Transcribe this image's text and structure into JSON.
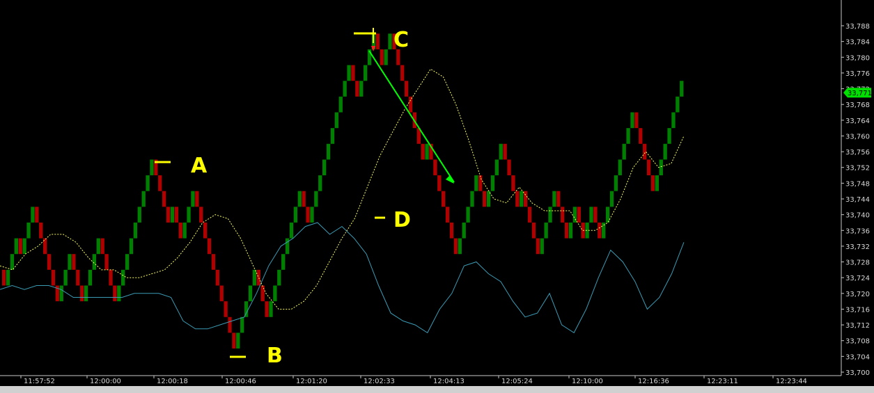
{
  "chart_data": {
    "type": "line",
    "x_ticks": [
      "11:57:52",
      "12:00:00",
      "12:00:18",
      "12:00:46",
      "12:01:20",
      "12:02:33",
      "12:04:13",
      "12:05:24",
      "12:10:00",
      "12:16:36",
      "12:23:11",
      "12:23:44"
    ],
    "y_ticks": [
      33788,
      33784,
      33780,
      33776,
      33772,
      33768,
      33764,
      33760,
      33756,
      33752,
      33748,
      33744,
      33740,
      33736,
      33732,
      33728,
      33724,
      33720,
      33716,
      33712,
      33708,
      33704,
      33700
    ],
    "ylim": [
      33700,
      33790
    ],
    "last_price": "33,771",
    "grid": false,
    "series": [
      {
        "kind": "renko_bricks",
        "color_up": "#008000",
        "color_down": "#b00000",
        "values": [
          33726,
          33722,
          33726,
          33730,
          33734,
          33730,
          33734,
          33738,
          33742,
          33738,
          33734,
          33730,
          33726,
          33722,
          33718,
          33722,
          33726,
          33730,
          33726,
          33722,
          33718,
          33722,
          33726,
          33730,
          33734,
          33730,
          33726,
          33722,
          33718,
          33722,
          33726,
          33730,
          33734,
          33738,
          33742,
          33746,
          33750,
          33754,
          33750,
          33746,
          33742,
          33738,
          33742,
          33738,
          33734,
          33738,
          33742,
          33746,
          33742,
          33738,
          33734,
          33730,
          33726,
          33722,
          33718,
          33714,
          33710,
          33706,
          33710,
          33714,
          33718,
          33722,
          33726,
          33722,
          33718,
          33714,
          33718,
          33722,
          33726,
          33730,
          33734,
          33738,
          33742,
          33746,
          33742,
          33738,
          33742,
          33746,
          33750,
          33754,
          33758,
          33762,
          33766,
          33770,
          33774,
          33778,
          33774,
          33770,
          33774,
          33778,
          33782,
          33786,
          33782,
          33778,
          33782,
          33786,
          33782,
          33778,
          33774,
          33770,
          33766,
          33762,
          33758,
          33754,
          33758,
          33754,
          33750,
          33746,
          33742,
          33738,
          33734,
          33730,
          33734,
          33738,
          33742,
          33746,
          33750,
          33746,
          33742,
          33746,
          33750,
          33754,
          33758,
          33754,
          33750,
          33746,
          33742,
          33746,
          33742,
          33738,
          33734,
          33730,
          33734,
          33738,
          33742,
          33746,
          33742,
          33738,
          33734,
          33738,
          33742,
          33738,
          33734,
          33738,
          33742,
          33738,
          33734,
          33738,
          33742,
          33746,
          33750,
          33754,
          33758,
          33762,
          33766,
          33762,
          33758,
          33754,
          33750,
          33746,
          33750,
          33754,
          33758,
          33762,
          33766,
          33770,
          33774
        ]
      },
      {
        "kind": "moving_average",
        "color": "#ffff66",
        "style": "dotted",
        "values": [
          33727,
          33726,
          33730,
          33732,
          33735,
          33735,
          33733,
          33729,
          33726,
          33726,
          33724,
          33724,
          33725,
          33726,
          33729,
          33733,
          33738,
          33740,
          33739,
          33734,
          33727,
          33720,
          33716,
          33716,
          33718,
          33722,
          33728,
          33734,
          33739,
          33747,
          33755,
          33761,
          33767,
          33772,
          33777,
          33775,
          33768,
          33759,
          33749,
          33744,
          33743,
          33747,
          33743,
          33741,
          33741,
          33741,
          33736,
          33736,
          33738,
          33744,
          33752,
          33756,
          33752,
          33753,
          33760
        ]
      },
      {
        "kind": "secondary_line",
        "color": "#3b9bb5",
        "values": [
          33721,
          33722,
          33721,
          33722,
          33722,
          33721,
          33719,
          33719,
          33719,
          33719,
          33719,
          33720,
          33720,
          33720,
          33719,
          33713,
          33711,
          33711,
          33712,
          33713,
          33714,
          33720,
          33727,
          33732,
          33734,
          33737,
          33738,
          33735,
          33737,
          33734,
          33730,
          33722,
          33715,
          33713,
          33712,
          33710,
          33716,
          33720,
          33727,
          33728,
          33725,
          33723,
          33718,
          33714,
          33715,
          33720,
          33712,
          33710,
          33716,
          33724,
          33731,
          33728,
          33723,
          33716,
          33719,
          33725,
          33733
        ]
      }
    ]
  },
  "annotations": {
    "A": "A",
    "B": "B",
    "C": "C",
    "D": "D"
  }
}
